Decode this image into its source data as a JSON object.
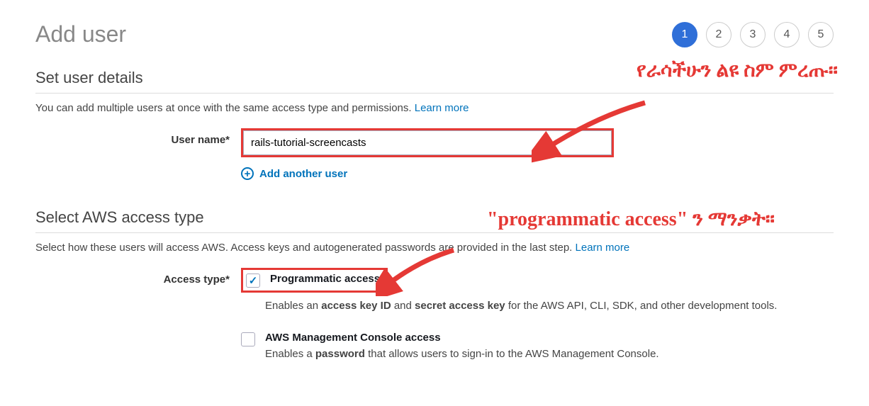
{
  "page": {
    "title": "Add user"
  },
  "steps": [
    "1",
    "2",
    "3",
    "4",
    "5"
  ],
  "activeStep": 0,
  "section1": {
    "title": "Set user details",
    "desc": "You can add multiple users at once with the same access type and permissions.",
    "learnMore": "Learn more",
    "userNameLabel": "User name*",
    "userNameValue": "rails-tutorial-screencasts",
    "addAnother": "Add another user"
  },
  "section2": {
    "title": "Select AWS access type",
    "desc": "Select how these users will access AWS. Access keys and autogenerated passwords are provided in the last step.",
    "learnMore": "Learn more",
    "accessTypeLabel": "Access type*",
    "options": [
      {
        "title": "Programmatic access",
        "checked": true,
        "descPrefix": "Enables an ",
        "bold1": "access key ID",
        "mid": " and ",
        "bold2": "secret access key",
        "descSuffix": " for the AWS API, CLI, SDK, and other development tools."
      },
      {
        "title": "AWS Management Console access",
        "checked": false,
        "descPrefix": "Enables a ",
        "bold1": "password",
        "mid": "",
        "bold2": "",
        "descSuffix": " that allows users to sign-in to the AWS Management Console."
      }
    ]
  },
  "annotations": {
    "ann1": "የራሳችሁን ልዩ ስም ምረጡ።",
    "ann2": "\"programmatic access\" ን ማንቃት።"
  }
}
